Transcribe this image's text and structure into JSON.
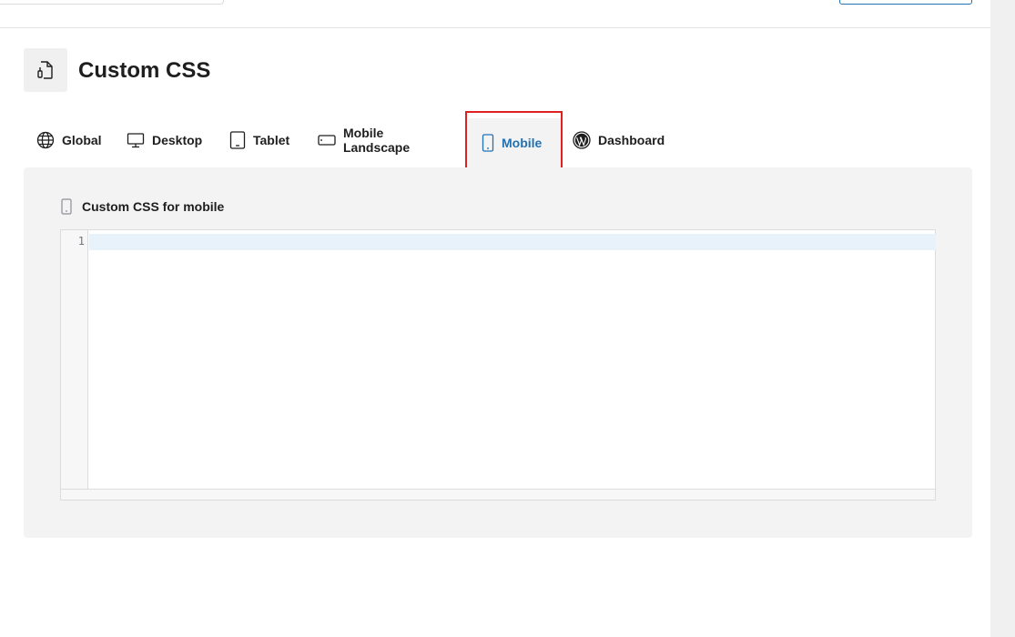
{
  "page": {
    "title": "Custom CSS",
    "icon": "css-file-icon"
  },
  "tabs": [
    {
      "label": "Global",
      "icon": "globe-icon"
    },
    {
      "label": "Desktop",
      "icon": "desktop-icon"
    },
    {
      "label": "Tablet",
      "icon": "tablet-icon"
    },
    {
      "label": "Mobile Landscape",
      "icon": "mobile-landscape-icon"
    },
    {
      "label": "Mobile",
      "icon": "mobile-icon",
      "active": true
    },
    {
      "label": "Dashboard",
      "icon": "wordpress-icon"
    }
  ],
  "panel": {
    "label": "Custom CSS for mobile",
    "icon": "mobile-icon"
  },
  "editor": {
    "line_numbers": [
      "1"
    ],
    "content": ""
  },
  "colors": {
    "accent": "#2271b1",
    "highlight": "#e21f1f",
    "panel_bg": "#f3f3f3"
  }
}
